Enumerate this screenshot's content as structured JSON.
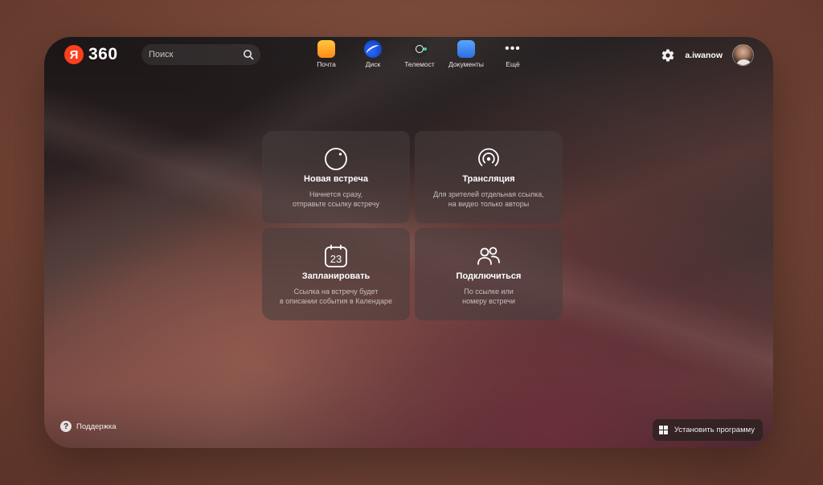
{
  "header": {
    "logo_letter": "Я",
    "logo_text": "360",
    "search_placeholder": "Поиск",
    "apps": [
      {
        "label": "Почта",
        "icon": "mail-icon"
      },
      {
        "label": "Диск",
        "icon": "disk-icon"
      },
      {
        "label": "Телемост",
        "icon": "telemost-icon"
      },
      {
        "label": "Документы",
        "icon": "documents-icon"
      },
      {
        "label": "Ещё",
        "icon": "more-icon"
      }
    ],
    "username": "a.iwanow"
  },
  "cards": [
    {
      "title": "Новая встреча",
      "desc": "Начнется сразу,\nотправьте ссылку встречу",
      "icon": "new-meeting-icon"
    },
    {
      "title": "Трансляция",
      "desc": "Для зрителей отдельная ссылка,\nна видео только авторы",
      "icon": "broadcast-icon"
    },
    {
      "title": "Запланировать",
      "desc": "Ссылка на встречу будет\nв описании события в Календаре",
      "icon": "calendar-icon",
      "calendar_day": "23"
    },
    {
      "title": "Подключиться",
      "desc": "По ссылке или\nномеру встречи",
      "icon": "join-people-icon"
    }
  ],
  "footer": {
    "support_label": "Поддержка",
    "install_label": "Установить программу"
  },
  "colors": {
    "brand_red": "#fc3f1d",
    "accent_green": "#3ddc84"
  }
}
